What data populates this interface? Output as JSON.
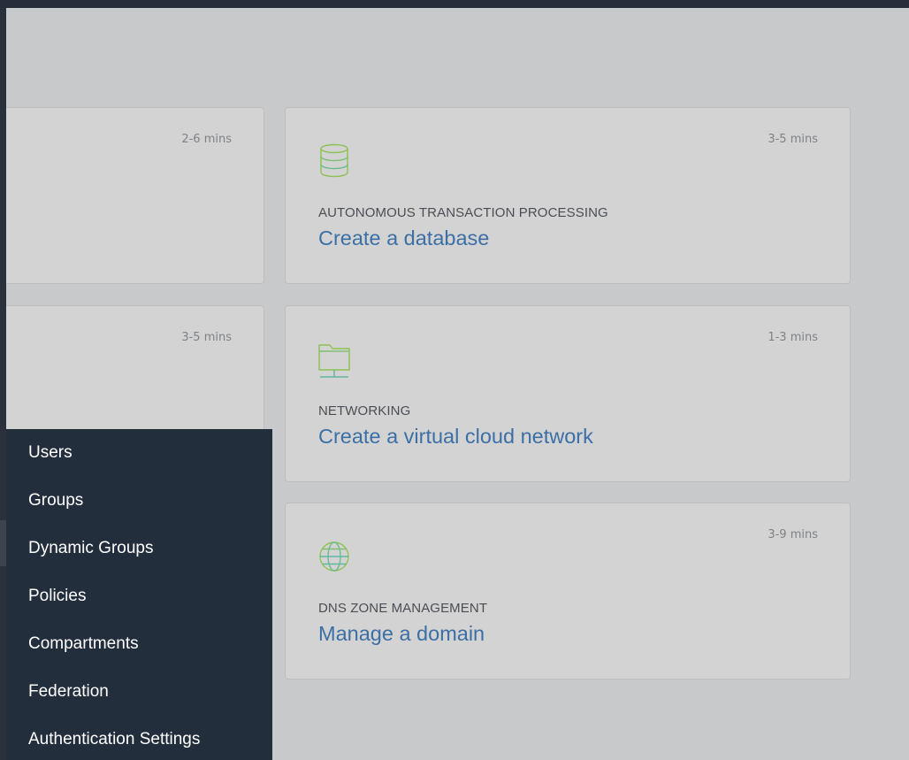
{
  "cards": [
    {
      "time": "2-6 mins"
    },
    {
      "time": "3-5 mins"
    },
    {
      "time": "3-5 mins",
      "icon": "database-icon",
      "category": "AUTONOMOUS TRANSACTION PROCESSING",
      "title": "Create a database"
    },
    {
      "time": "1-3 mins",
      "icon": "network-folder-icon",
      "category": "NETWORKING",
      "title": "Create a virtual cloud network"
    },
    {
      "time": "3-9 mins",
      "icon": "globe-icon",
      "category": "DNS ZONE MANAGEMENT",
      "title": "Manage a domain"
    }
  ],
  "menu": {
    "items": [
      {
        "label": "Users"
      },
      {
        "label": "Groups"
      },
      {
        "label": "Dynamic Groups"
      },
      {
        "label": "Policies"
      },
      {
        "label": "Compartments"
      },
      {
        "label": "Federation"
      },
      {
        "label": "Authentication Settings"
      }
    ]
  },
  "colors": {
    "background": "#c8c9ca",
    "card": "#d3d3d3",
    "link": "#3b6fa6",
    "menu_bg": "#232e3d",
    "topbar": "#252e3a",
    "icon_green": "#8dc153",
    "icon_teal": "#5fb7a4"
  }
}
